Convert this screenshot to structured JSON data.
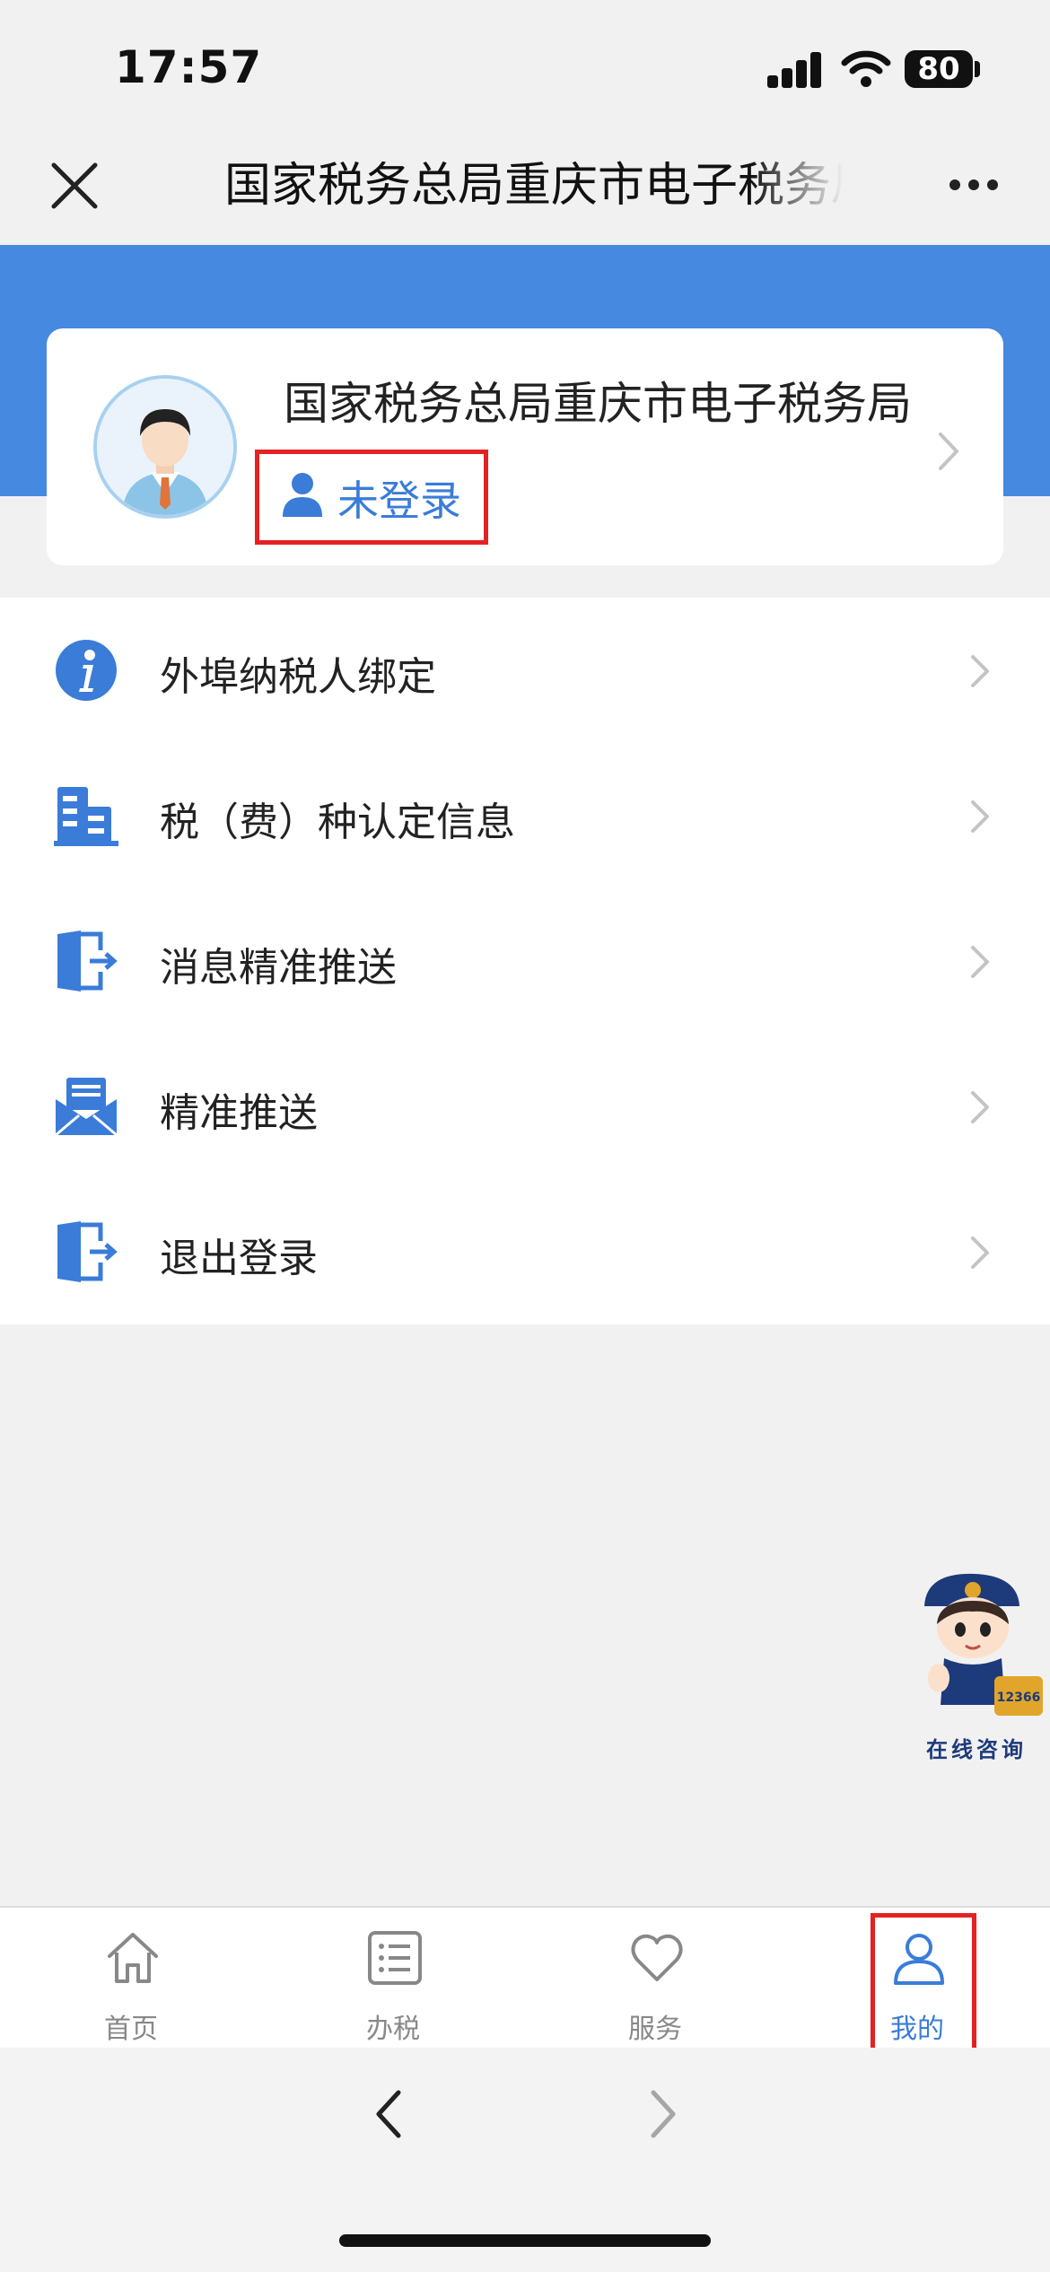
{
  "status_bar": {
    "time": "17:57",
    "battery": "80"
  },
  "header": {
    "title": "国家税务总局重庆市电子税务局"
  },
  "profile": {
    "org_name": "国家税务总局重庆市电子税务局",
    "login_status": "未登录"
  },
  "menu": {
    "items": [
      {
        "label": "外埠纳税人绑定",
        "icon": "info-icon"
      },
      {
        "label": "税（费）种认定信息",
        "icon": "building-icon"
      },
      {
        "label": "消息精准推送",
        "icon": "door-exit-icon"
      },
      {
        "label": "精准推送",
        "icon": "envelope-icon"
      },
      {
        "label": "退出登录",
        "icon": "door-exit-icon"
      }
    ]
  },
  "mascot": {
    "label": "在线咨询",
    "badge": "12366"
  },
  "tabbar": {
    "tabs": [
      {
        "label": "首页",
        "icon": "home-icon"
      },
      {
        "label": "办税",
        "icon": "list-icon"
      },
      {
        "label": "服务",
        "icon": "heart-icon"
      },
      {
        "label": "我的",
        "icon": "user-icon"
      }
    ],
    "active_index": 3
  },
  "colors": {
    "brand_blue": "#4589e1",
    "accent_blue": "#3a7cd8",
    "highlight_red": "#e52222"
  }
}
